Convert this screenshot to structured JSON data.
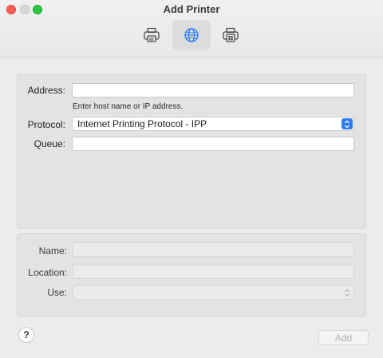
{
  "window": {
    "title": "Add Printer"
  },
  "toolbar": {
    "buttons": [
      {
        "icon": "printer-icon",
        "name": "Default"
      },
      {
        "icon": "globe-icon",
        "name": "IP",
        "active": true
      },
      {
        "icon": "windows-printer-icon",
        "name": "Windows"
      }
    ]
  },
  "form": {
    "address": {
      "label": "Address:",
      "value": "",
      "hint": "Enter host name or IP address."
    },
    "protocol": {
      "label": "Protocol:",
      "value": "Internet Printing Protocol - IPP"
    },
    "queue": {
      "label": "Queue:",
      "value": ""
    }
  },
  "details": {
    "name": {
      "label": "Name:",
      "value": ""
    },
    "location": {
      "label": "Location:",
      "value": ""
    },
    "use": {
      "label": "Use:",
      "value": ""
    }
  },
  "footer": {
    "help_label": "?",
    "add_label": "Add"
  },
  "colors": {
    "accent": "#2f7cf6",
    "close": "#ff5f57",
    "maximize": "#28c840"
  }
}
